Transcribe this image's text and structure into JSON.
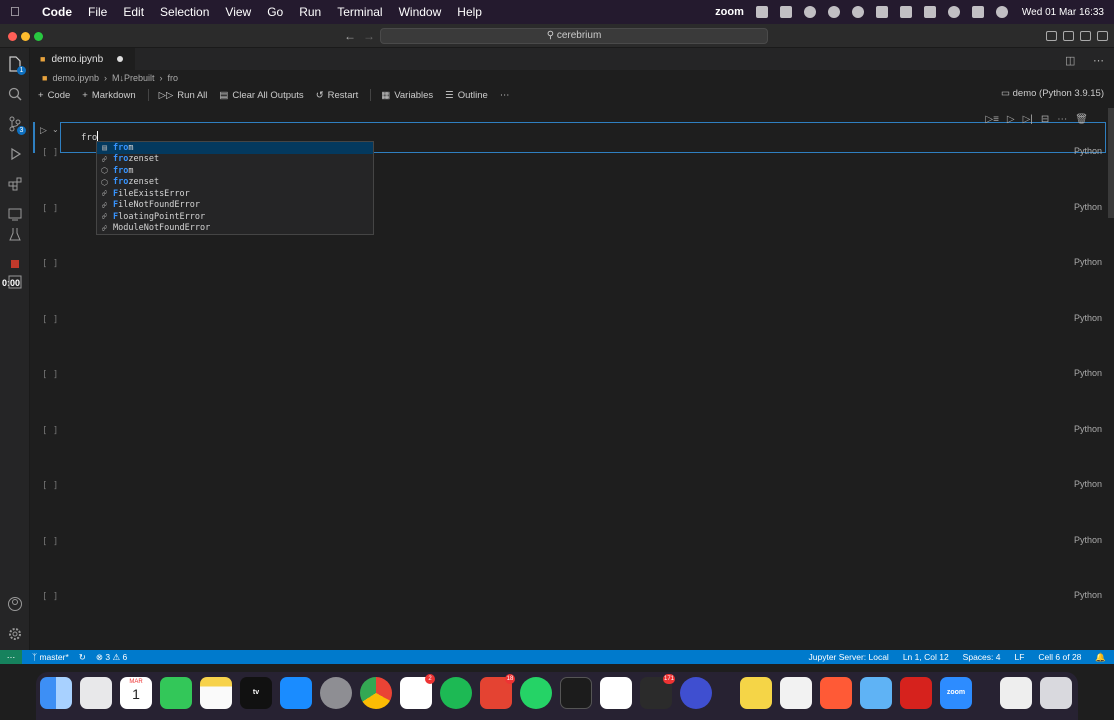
{
  "menubar": {
    "app": "Code",
    "items": [
      "File",
      "Edit",
      "Selection",
      "View",
      "Go",
      "Run",
      "Terminal",
      "Window",
      "Help"
    ],
    "zoom": "zoom",
    "datetime": "Wed 01 Mar  16:33"
  },
  "titlebar": {
    "search": "cerebrium"
  },
  "tab": {
    "name": "demo.ipynb"
  },
  "breadcrumb": [
    "demo.ipynb",
    "M↓Prebuilt",
    "fro"
  ],
  "toolbar": {
    "code": "Code",
    "markdown": "Markdown",
    "run_all": "Run All",
    "clear_outputs": "Clear All Outputs",
    "restart": "Restart",
    "variables": "Variables",
    "outline": "Outline",
    "more": "⋯",
    "kernel": "demo (Python 3.9.15)"
  },
  "activity": {
    "timer": "0:00",
    "explorer_badge": "1",
    "scm_badge": "3"
  },
  "active_cell": {
    "code": "fro",
    "language": "Python"
  },
  "cells": [
    {
      "exec": "[ ]",
      "language": "Python"
    },
    {
      "exec": "[ ]",
      "language": "Python"
    },
    {
      "exec": "[ ]",
      "language": "Python"
    },
    {
      "exec": "[ ]",
      "language": "Python"
    },
    {
      "exec": "[ ]",
      "language": "Python"
    },
    {
      "exec": "[ ]",
      "language": "Python"
    },
    {
      "exec": "[ ]",
      "language": "Python"
    },
    {
      "exec": "[ ]",
      "language": "Python"
    },
    {
      "exec": "[ ]",
      "language": "Python"
    }
  ],
  "suggestions": [
    {
      "pre": "",
      "match": "fro",
      "rest": "m",
      "kind": "keyword-icon"
    },
    {
      "pre": "",
      "match": "fro",
      "rest": "zenset",
      "kind": "class-icon"
    },
    {
      "pre": "",
      "match": "fro",
      "rest": "m",
      "kind": "snippet-icon"
    },
    {
      "pre": "",
      "match": "fro",
      "rest": "zenset",
      "kind": "snippet-icon"
    },
    {
      "pre": "",
      "match": "F",
      "rest": "ileExistsError",
      "kind": "class-icon"
    },
    {
      "pre": "",
      "match": "F",
      "rest": "ileNotFoundError",
      "kind": "class-icon"
    },
    {
      "pre": "",
      "match": "F",
      "rest": "loatingPointError",
      "kind": "class-icon"
    },
    {
      "pre": "",
      "match": "",
      "rest": "ModuleNotFoundError",
      "kind": "class-icon"
    }
  ],
  "statusbar": {
    "branch": "master*",
    "problems": "⊗ 3 ⚠ 6",
    "jupyter": "Jupyter Server: Local",
    "position": "Ln 1, Col 12",
    "spaces": "Spaces: 4",
    "eol": "LF",
    "cell": "Cell 6 of 28"
  },
  "dock": {
    "calendar_month": "MAR",
    "calendar_day": "1",
    "tv": "tv",
    "zoom": "zoom",
    "slack_badge": "2",
    "todoist_badge": "18",
    "linear_badge": "171"
  },
  "colors": {
    "accent": "#007acc",
    "selection": "#04395e",
    "match_highlight": "#3794ff",
    "active_cell_border": "#2f7fc0"
  }
}
